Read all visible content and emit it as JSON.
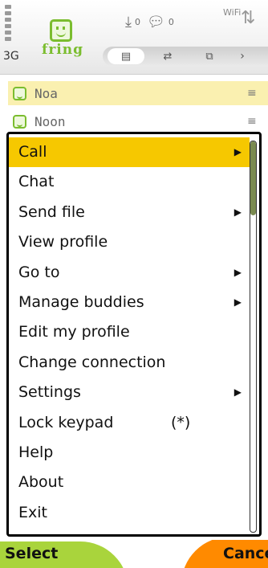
{
  "status_bar": {
    "network": "3G",
    "download_count": "0",
    "message_count": "0",
    "wifi_label": "WiFi",
    "app_logo_text": "fring"
  },
  "tabs": [
    {
      "icon": "contacts-list-icon"
    },
    {
      "icon": "transfer-arrows-icon"
    },
    {
      "icon": "window-icon"
    }
  ],
  "buddies": [
    {
      "name": "Noa",
      "selected": true
    },
    {
      "name": "Noon",
      "selected": false
    }
  ],
  "menu": {
    "items": [
      {
        "label": "Call",
        "submenu": true,
        "highlighted": true
      },
      {
        "label": "Chat",
        "submenu": false
      },
      {
        "label": "Send file",
        "submenu": true
      },
      {
        "label": "View profile",
        "submenu": false
      },
      {
        "label": "Go to",
        "submenu": true
      },
      {
        "label": "Manage buddies",
        "submenu": true
      },
      {
        "label": "Edit my profile",
        "submenu": false
      },
      {
        "label": "Change connection",
        "submenu": false
      },
      {
        "label": "Settings",
        "submenu": true
      },
      {
        "label": "Lock keypad",
        "submenu": false,
        "shortcut": "(*)"
      },
      {
        "label": "Help",
        "submenu": false
      },
      {
        "label": "About",
        "submenu": false
      },
      {
        "label": "Exit",
        "submenu": false
      }
    ],
    "highlight_color": "#f6c800"
  },
  "softkeys": {
    "left": "Select",
    "right": "Cance",
    "left_color": "#a9d43c",
    "right_color": "#ff8a00"
  }
}
